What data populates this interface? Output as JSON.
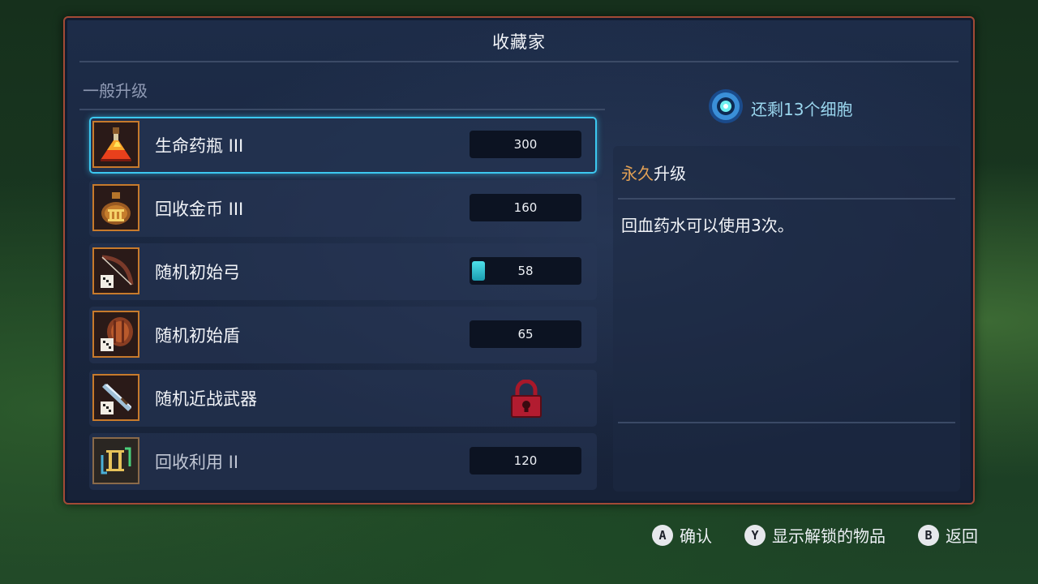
{
  "panel": {
    "title": "收藏家",
    "section_label": "一般升级"
  },
  "items": [
    {
      "label": "生命药瓶 III",
      "cost": "300",
      "icon": "health-flask-icon",
      "selected": true
    },
    {
      "label": "回收金币 III",
      "cost": "160",
      "icon": "gold-bag-icon"
    },
    {
      "label": "随机初始弓",
      "cost": "58",
      "icon": "random-bow-icon",
      "progress_fraction": 0.12
    },
    {
      "label": "随机初始盾",
      "cost": "65",
      "icon": "random-shield-icon"
    },
    {
      "label": "随机近战武器",
      "icon": "random-melee-icon",
      "locked": true
    },
    {
      "label": "回收利用 II",
      "cost": "120",
      "icon": "recycle-icon"
    }
  ],
  "cells": {
    "text": "还剩13个细胞",
    "icon": "cell-icon"
  },
  "detail": {
    "title_accent": "永久",
    "title_rest": "升级",
    "description": "回血药水可以使用3次。"
  },
  "footer": {
    "confirm": {
      "glyph": "A",
      "label": "确认"
    },
    "show_unlocked": {
      "glyph": "Y",
      "label": "显示解锁的物品"
    },
    "back": {
      "glyph": "B",
      "label": "返回"
    }
  },
  "colors": {
    "panel_border": "#a24a36",
    "selection": "#3cc8f0",
    "accent": "#e3a155",
    "cell_text": "#9ad6ee"
  }
}
